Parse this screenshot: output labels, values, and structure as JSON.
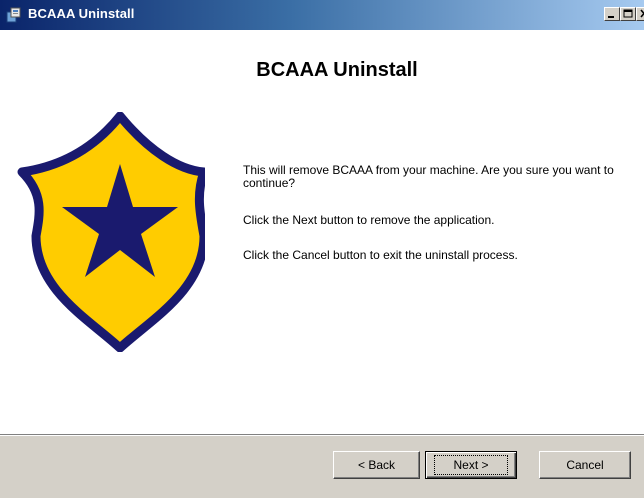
{
  "window": {
    "title": "BCAAA Uninstall",
    "controls": {
      "minimize": "_",
      "maximize": "□",
      "close": "✕"
    }
  },
  "main": {
    "heading": "BCAAA Uninstall",
    "messages": [
      "This will remove BCAAA from your machine. Are you sure you want to continue?",
      "Click the Next button to remove the application.",
      "Click the Cancel button to exit the uninstall process."
    ],
    "icon": "shield-star-icon",
    "colors": {
      "shield_fill": "#ffcc00",
      "shield_border": "#1a1a6e",
      "star": "#1a1a6e"
    }
  },
  "buttons": {
    "back": "< Back",
    "next": "Next >",
    "cancel": "Cancel"
  }
}
